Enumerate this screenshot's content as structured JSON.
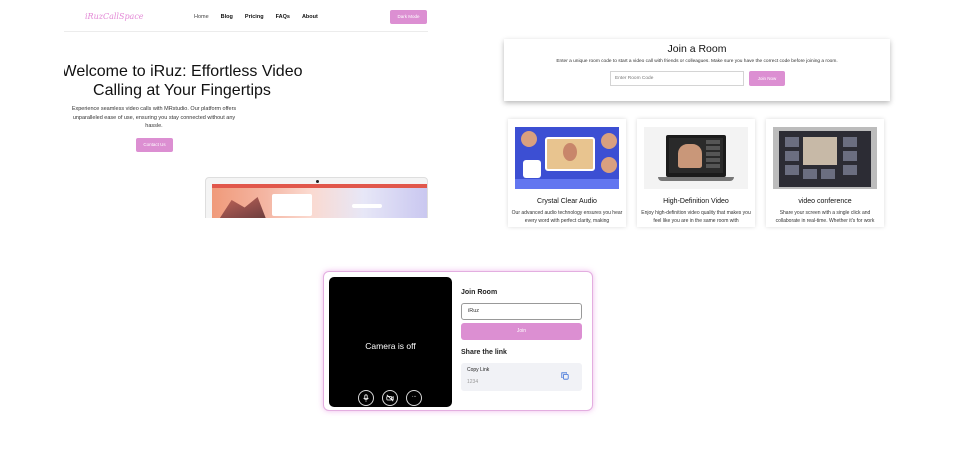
{
  "landing": {
    "logo": "iRuzCallSpace",
    "nav": [
      "Home",
      "Blog",
      "Pricing",
      "FAQs",
      "About"
    ],
    "mode_button": "Dark Mode",
    "hero_title": "Welcome to iRuz: Effortless Video Calling at Your Fingertips",
    "hero_text": "Experience seamless video calls with MRstudio. Our platform offers unparalleled ease of use, ensuring you stay connected without any hassle.",
    "contact_button": "Contact Us",
    "colors": {
      "accent": "#dc8fd2",
      "logo": "#e389d6"
    }
  },
  "join_page": {
    "title": "Join a Room",
    "description": "Enter a unique room code to start a video call with friends or colleagues. Make sure you have the correct code before joining a room.",
    "room_input_placeholder": "Enter Room Code",
    "join_button": "Join Now",
    "features": [
      {
        "title": "Crystal Clear Audio",
        "text": "Our advanced audio technology ensures you hear every word with perfect clarity, making"
      },
      {
        "title": "High-Definition Video",
        "text": "Enjoy high-definition video quality that makes you feel like you are in the same room with"
      },
      {
        "title": "video conference",
        "text": "Share your screen with a single click and collaborate in real-time. Whether it's for work"
      }
    ]
  },
  "call_widget": {
    "camera_status": "Camera is off",
    "controls": [
      "mic-icon",
      "camera-off-icon",
      "more-icon"
    ],
    "join_room_title": "Join Room",
    "name_value": "iRuz",
    "join_button": "Join",
    "share_title": "Share the link",
    "copy_label": "Copy Link",
    "copy_value": "1234",
    "colors": {
      "border": "#e3aee0",
      "button": "#dc8fd2"
    }
  }
}
